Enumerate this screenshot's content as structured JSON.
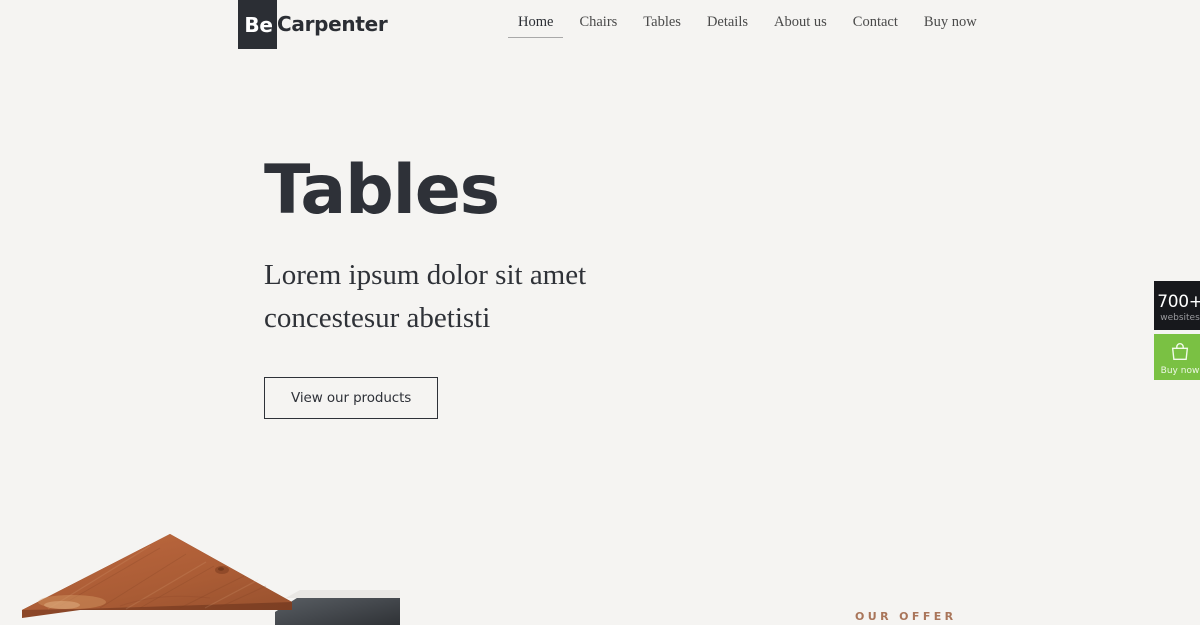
{
  "colors": {
    "background": "#f5f4f2",
    "ink": "#2e3138",
    "logo_box": "#2b2e34",
    "nav_text": "#4a4a4a",
    "eyebrow": "#a9755a",
    "widget_dark": "#17181c",
    "widget_green": "#7ac143",
    "wood": "#b4623a",
    "slate": "#3f4348"
  },
  "header": {
    "logo": {
      "badge_text": "Be",
      "word_text": "Carpenter"
    },
    "nav": [
      {
        "label": "Home",
        "active": true
      },
      {
        "label": "Chairs",
        "active": false
      },
      {
        "label": "Tables",
        "active": false
      },
      {
        "label": "Details",
        "active": false
      },
      {
        "label": "About us",
        "active": false
      },
      {
        "label": "Contact",
        "active": false
      },
      {
        "label": "Buy now",
        "active": false
      }
    ]
  },
  "hero": {
    "title": "Tables",
    "subtitle": "Lorem ipsum dolor sit amet concestesur abetisti",
    "cta_label": "View our products"
  },
  "section": {
    "eyebrow": "OUR OFFER"
  },
  "side_widgets": {
    "count_widget": {
      "number": "700+",
      "label": "websites"
    },
    "buy_widget": {
      "icon": "shopping-bag-icon",
      "label": "Buy now"
    }
  },
  "product_art": {
    "name": "wooden-table-top",
    "description": "isometric wooden table top with slate panel"
  }
}
